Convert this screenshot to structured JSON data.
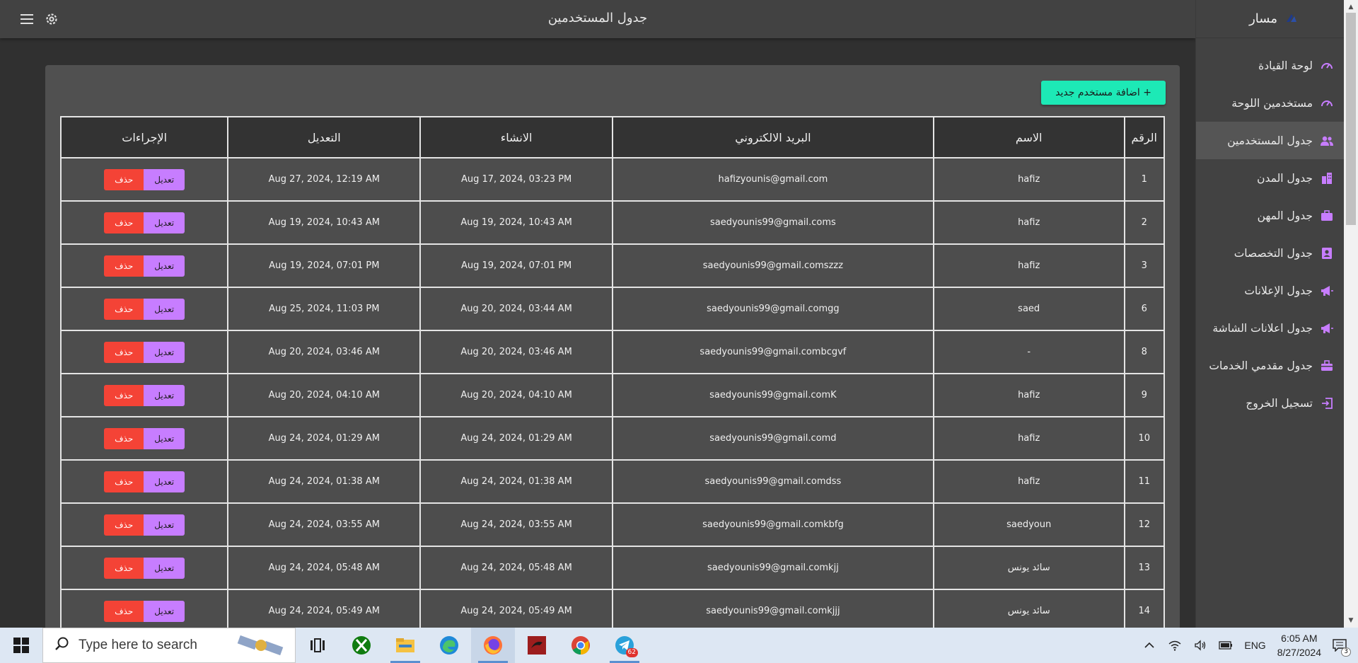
{
  "header": {
    "title": "جدول المستخدمين"
  },
  "sidebar": {
    "brand": "مسار",
    "items": [
      {
        "label": "لوحة القيادة",
        "icon": "speedometer-icon",
        "active": false
      },
      {
        "label": "مستخدمين اللوحة",
        "icon": "speedometer-icon",
        "active": false
      },
      {
        "label": "جدول المستخدمين",
        "icon": "people-icon",
        "active": true
      },
      {
        "label": "جدول المدن",
        "icon": "city-icon",
        "active": false
      },
      {
        "label": "جدول المهن",
        "icon": "briefcase-icon",
        "active": false
      },
      {
        "label": "جدول التخصصات",
        "icon": "id-badge-icon",
        "active": false
      },
      {
        "label": "جدول الإعلانات",
        "icon": "megaphone-icon",
        "active": false
      },
      {
        "label": "جدول اعلانات الشاشة",
        "icon": "megaphone-icon",
        "active": false
      },
      {
        "label": "جدول مقدمي الخدمات",
        "icon": "toolbox-icon",
        "active": false
      },
      {
        "label": "تسجيل الخروج",
        "icon": "logout-icon",
        "active": false
      }
    ]
  },
  "main": {
    "add_button": "اضافة مستخدم جديد +",
    "table": {
      "columns": [
        "الرقم",
        "الاسم",
        "البريد الالكتروني",
        "الانشاء",
        "التعديل",
        "الإجراءات"
      ],
      "edit_label": "تعديل",
      "delete_label": "حذف",
      "rows": [
        {
          "id": "1",
          "name": "hafiz",
          "email": "hafizyounis@gmail.com",
          "created": "Aug 17, 2024, 03:23 PM",
          "updated": "Aug 27, 2024, 12:19 AM"
        },
        {
          "id": "2",
          "name": "hafiz",
          "email": "saedyounis99@gmail.coms",
          "created": "Aug 19, 2024, 10:43 AM",
          "updated": "Aug 19, 2024, 10:43 AM"
        },
        {
          "id": "3",
          "name": "hafiz",
          "email": "saedyounis99@gmail.comszzz",
          "created": "Aug 19, 2024, 07:01 PM",
          "updated": "Aug 19, 2024, 07:01 PM"
        },
        {
          "id": "6",
          "name": "saed",
          "email": "saedyounis99@gmail.comgg",
          "created": "Aug 20, 2024, 03:44 AM",
          "updated": "Aug 25, 2024, 11:03 PM"
        },
        {
          "id": "8",
          "name": "-",
          "email": "saedyounis99@gmail.combcgvf",
          "created": "Aug 20, 2024, 03:46 AM",
          "updated": "Aug 20, 2024, 03:46 AM"
        },
        {
          "id": "9",
          "name": "hafiz",
          "email": "saedyounis99@gmail.comK",
          "created": "Aug 20, 2024, 04:10 AM",
          "updated": "Aug 20, 2024, 04:10 AM"
        },
        {
          "id": "10",
          "name": "hafiz",
          "email": "saedyounis99@gmail.comd",
          "created": "Aug 24, 2024, 01:29 AM",
          "updated": "Aug 24, 2024, 01:29 AM"
        },
        {
          "id": "11",
          "name": "hafiz",
          "email": "saedyounis99@gmail.comdss",
          "created": "Aug 24, 2024, 01:38 AM",
          "updated": "Aug 24, 2024, 01:38 AM"
        },
        {
          "id": "12",
          "name": "saedyoun",
          "email": "saedyounis99@gmail.comkbfg",
          "created": "Aug 24, 2024, 03:55 AM",
          "updated": "Aug 24, 2024, 03:55 AM"
        },
        {
          "id": "13",
          "name": "سائد يونس",
          "email": "saedyounis99@gmail.comkjj",
          "created": "Aug 24, 2024, 05:48 AM",
          "updated": "Aug 24, 2024, 05:48 AM"
        },
        {
          "id": "14",
          "name": "سائد يونس",
          "email": "saedyounis99@gmail.comkjjj",
          "created": "Aug 24, 2024, 05:49 AM",
          "updated": "Aug 24, 2024, 05:49 AM"
        }
      ]
    }
  },
  "taskbar": {
    "search_placeholder": "Type here to search",
    "apps": [
      {
        "name": "task-view-icon"
      },
      {
        "name": "xbox-icon"
      },
      {
        "name": "file-explorer-icon"
      },
      {
        "name": "edge-icon"
      },
      {
        "name": "firefox-icon"
      },
      {
        "name": "red-app-icon"
      },
      {
        "name": "chrome-icon"
      },
      {
        "name": "telegram-icon"
      }
    ],
    "telegram_badge": "62",
    "language": "ENG",
    "time": "6:05 AM",
    "date": "8/27/2024",
    "notification_count": "3"
  },
  "colors": {
    "background": "#303030",
    "appbar": "#424242",
    "card": "#505050",
    "add_button": "#1de9b6",
    "edit_button": "#c77dff",
    "delete_button": "#f44336",
    "accent_icon": "#c77dff"
  }
}
